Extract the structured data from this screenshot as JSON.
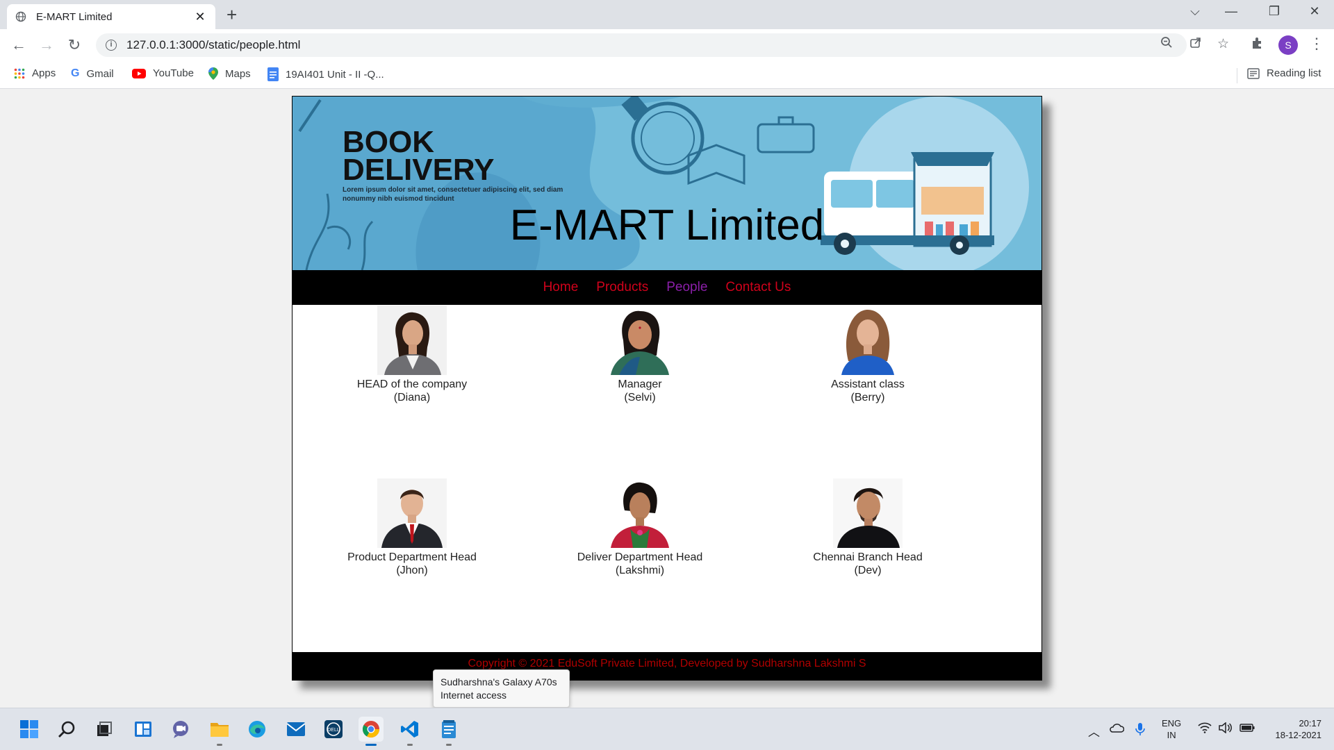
{
  "browser": {
    "tab_title": "E-MART Limited",
    "tab_close": "✕",
    "new_tab": "+",
    "url": "127.0.0.1:3000/static/people.html",
    "profile_initial": "S",
    "window_controls": {
      "dropdown": "⌵",
      "minimize": "—",
      "restore": "❐",
      "close": "✕"
    },
    "bookmarks": [
      {
        "label": "Apps",
        "icon": "apps-grid-icon"
      },
      {
        "label": "Gmail",
        "icon": "google-icon"
      },
      {
        "label": "YouTube",
        "icon": "youtube-icon"
      },
      {
        "label": "Maps",
        "icon": "maps-pin-icon"
      },
      {
        "label": "19AI401 Unit - II -Q...",
        "icon": "docs-icon"
      }
    ],
    "reading_list": "Reading list"
  },
  "site": {
    "banner": {
      "headline_line1": "BOOK",
      "headline_line2": "DELIVERY",
      "lorem": "Lorem ipsum dolor sit amet, consectetuer adipiscing elit, sed diam nonummy nibh euismod tincidunt"
    },
    "title": "E-MART Limited",
    "nav": [
      "Home",
      "Products",
      "People",
      "Contact Us"
    ],
    "active_nav": "People",
    "people": [
      {
        "role": "HEAD of the company",
        "name": "(Diana)"
      },
      {
        "role": "Manager",
        "name": "(Selvi)"
      },
      {
        "role": "Assistant class",
        "name": "(Berry)"
      },
      {
        "role": "Product Department Head",
        "name": "(Jhon)"
      },
      {
        "role": "Deliver Department Head",
        "name": "(Lakshmi)"
      },
      {
        "role": "Chennai Branch Head",
        "name": "(Dev)"
      }
    ],
    "footer": "Copyright © 2021 EduSoft Private Limited, Developed by Sudharshna Lakshmi S"
  },
  "tooltip": {
    "line1": "Sudharshna's Galaxy A70s",
    "line2": "Internet access"
  },
  "taskbar": {
    "apps": [
      "start-icon",
      "search-icon",
      "task-view-icon",
      "widgets-icon",
      "teams-chat-icon",
      "file-explorer-icon",
      "edge-icon",
      "mail-icon",
      "dell-icon",
      "chrome-icon",
      "vscode-icon",
      "notepad-icon"
    ],
    "language_line1": "ENG",
    "language_line2": "IN",
    "time": "20:17",
    "date": "18-12-2021"
  },
  "colors": {
    "nav_link": "#d0021b",
    "nav_active": "#8b1fa9",
    "banner_bg": "#6eb8d8",
    "footer_text": "#b00000"
  }
}
